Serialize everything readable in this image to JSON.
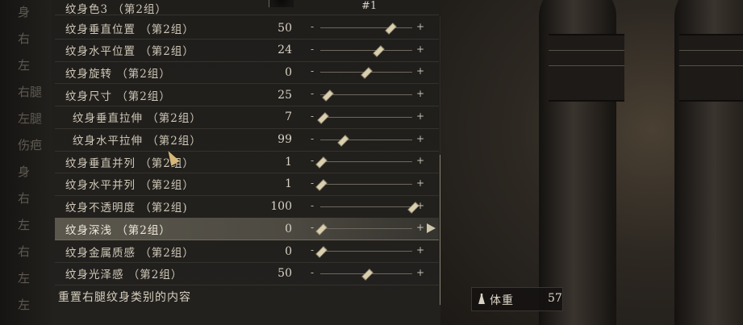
{
  "categories": [
    "身",
    "右",
    "左",
    "右腿",
    "左腿",
    "伤疤",
    "身",
    "右",
    "左",
    "右",
    "左",
    "左"
  ],
  "color_row": {
    "label": "纹身色3 （第2组）",
    "code": "#1"
  },
  "rows": [
    {
      "label": "纹身垂直位置 （第2组）",
      "value": "50",
      "level": 0.75,
      "sub": false,
      "selected": false
    },
    {
      "label": "纹身水平位置 （第2组）",
      "value": "24",
      "level": 0.62,
      "sub": false,
      "selected": false
    },
    {
      "label": "纹身旋转 （第2组）",
      "value": "0",
      "level": 0.49,
      "sub": false,
      "selected": false
    },
    {
      "label": "纹身尺寸 （第2组）",
      "value": "25",
      "level": 0.07,
      "sub": false,
      "selected": false
    },
    {
      "label": "纹身垂直拉伸 （第2组）",
      "value": "7",
      "level": 0.02,
      "sub": true,
      "selected": false
    },
    {
      "label": "纹身水平拉伸 （第2组）",
      "value": "99",
      "level": 0.24,
      "sub": true,
      "selected": false
    },
    {
      "label": "纹身垂直并列 （第2组）",
      "value": "1",
      "level": 0.0,
      "sub": false,
      "selected": false
    },
    {
      "label": "纹身水平并列 （第2组）",
      "value": "1",
      "level": 0.0,
      "sub": false,
      "selected": false
    },
    {
      "label": "纹身不透明度 （第2组)",
      "value": "100",
      "level": 1.0,
      "sub": false,
      "selected": false
    },
    {
      "label": "纹身深浅 （第2组）",
      "value": "0",
      "level": 0.0,
      "sub": false,
      "selected": true
    },
    {
      "label": "纹身金属质感 （第2组）",
      "value": "0",
      "level": 0.0,
      "sub": false,
      "selected": false
    },
    {
      "label": "纹身光泽感 （第2组）",
      "value": "50",
      "level": 0.5,
      "sub": false,
      "selected": false
    }
  ],
  "reset_label": "重置右腿纹身类别的内容",
  "minus_symbol": "-",
  "plus_symbol": "+",
  "weight": {
    "label": "体重",
    "value": "57"
  }
}
